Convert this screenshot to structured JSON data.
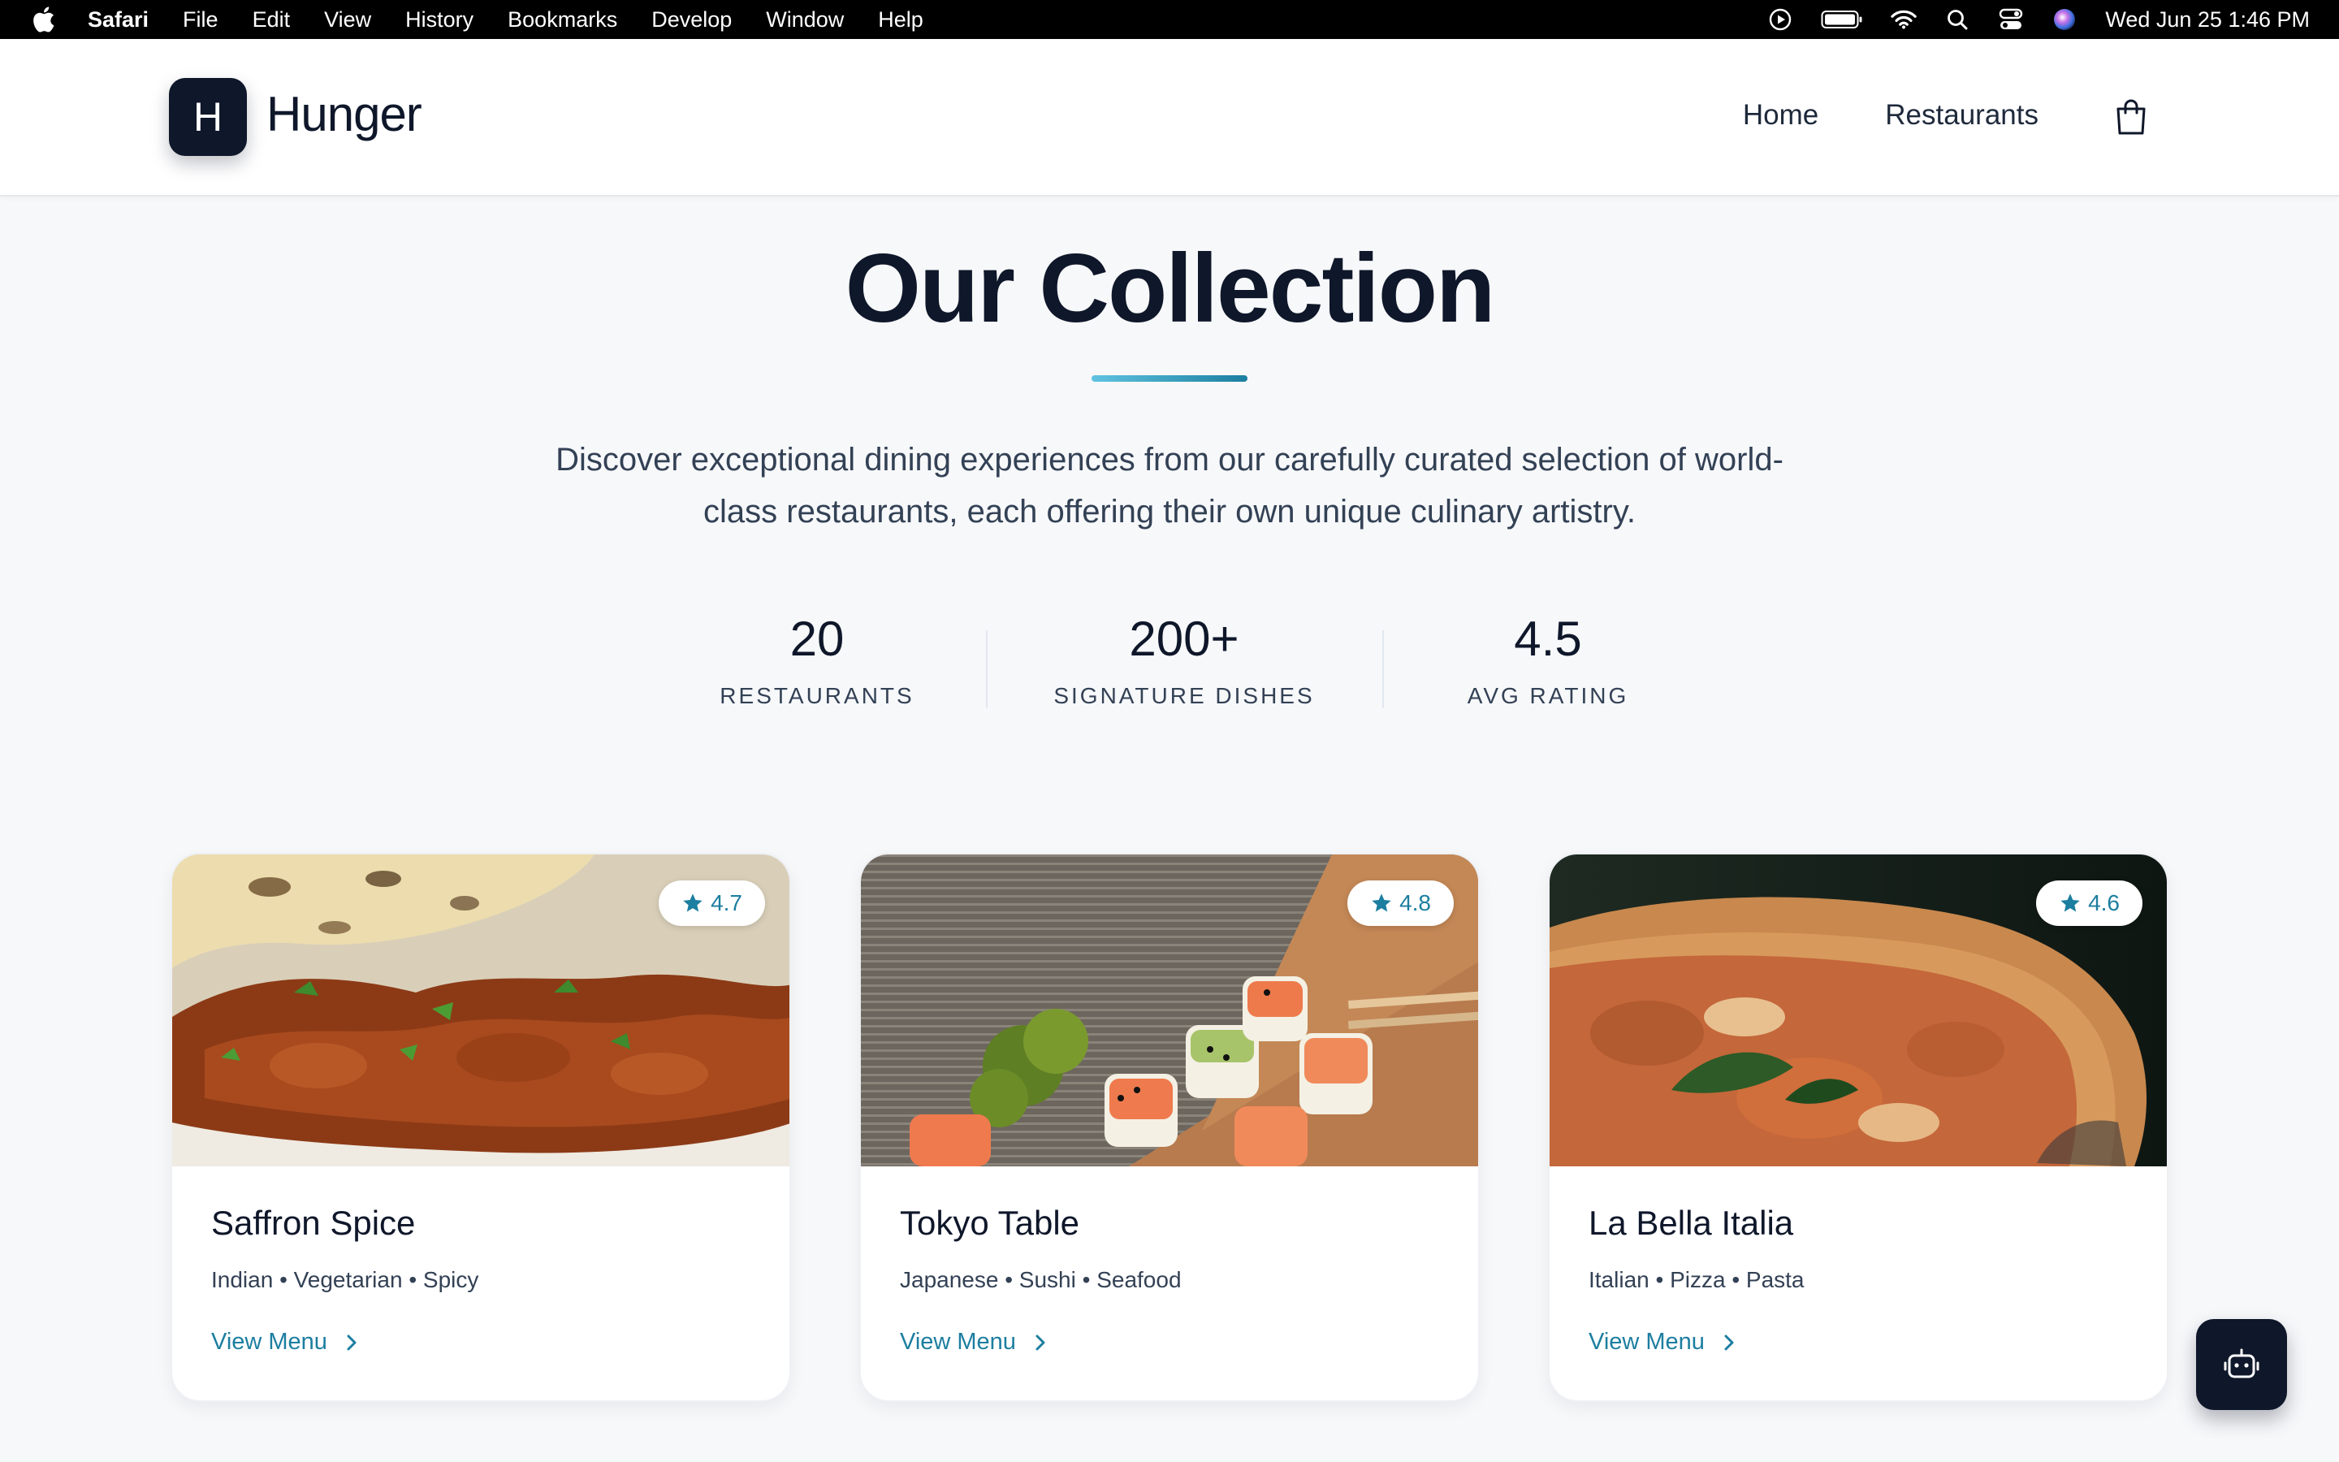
{
  "menubar": {
    "app_name": "Safari",
    "items": [
      "File",
      "Edit",
      "View",
      "History",
      "Bookmarks",
      "Develop",
      "Window",
      "Help"
    ],
    "datetime": "Wed Jun 25  1:46 PM"
  },
  "header": {
    "logo_letter": "H",
    "brand": "Hunger",
    "nav": [
      "Home",
      "Restaurants"
    ]
  },
  "hero": {
    "title": "Our Collection",
    "description": "Discover exceptional dining experiences from our carefully curated selection of world-class restaurants, each offering their own unique culinary artistry."
  },
  "stats": [
    {
      "value": "20",
      "label": "RESTAURANTS"
    },
    {
      "value": "200+",
      "label": "SIGNATURE DISHES"
    },
    {
      "value": "4.5",
      "label": "AVG RATING"
    }
  ],
  "restaurants": [
    {
      "name": "Saffron Spice",
      "tags": "Indian • Vegetarian • Spicy",
      "rating": "4.7",
      "cta": "View Menu"
    },
    {
      "name": "Tokyo Table",
      "tags": "Japanese • Sushi • Seafood",
      "rating": "4.8",
      "cta": "View Menu"
    },
    {
      "name": "La Bella Italia",
      "tags": "Italian • Pizza • Pasta",
      "rating": "4.6",
      "cta": "View Menu"
    }
  ],
  "colors": {
    "brand_dark": "#0f172a",
    "accent": "#1c7ea0"
  }
}
